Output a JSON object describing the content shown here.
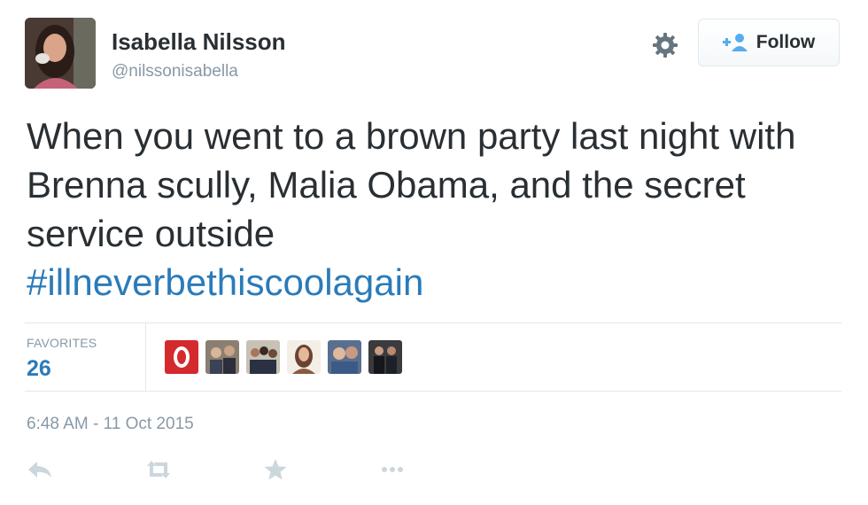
{
  "user": {
    "name": "Isabella Nilsson",
    "handle": "@nilssonisabella"
  },
  "follow_button": {
    "label": "Follow",
    "icon": "add-person-icon"
  },
  "settings_icon": "gear-icon",
  "tweet": {
    "text": "When you went to a brown party last night with Brenna scully, Malia Obama, and the secret service outside",
    "hashtag": "#illneverbethiscoolagain"
  },
  "stats": {
    "favorites_label": "FAVORITES",
    "favorites_count": "26"
  },
  "timestamp": "6:48 AM - 11 Oct 2015",
  "actions": [
    "reply-icon",
    "retweet-icon",
    "favorite-icon",
    "more-icon"
  ],
  "colors": {
    "link": "#2b7bb9",
    "muted": "#8899a6",
    "text": "#292f33"
  }
}
